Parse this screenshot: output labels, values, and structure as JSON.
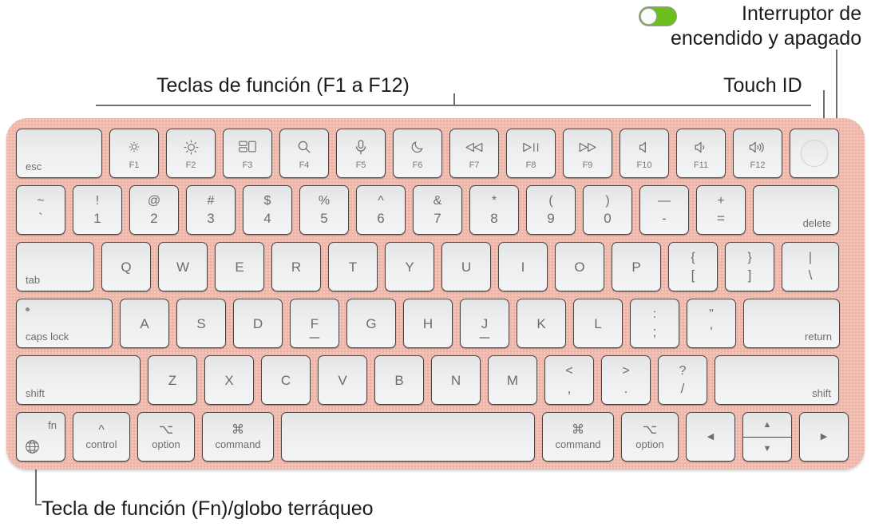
{
  "annotations": {
    "power_switch": {
      "line1": "Interruptor de",
      "line2": "encendido y apagado",
      "toggle_color": "#6dbe1e"
    },
    "touch_id": "Touch ID",
    "function_keys": "Teclas de función (F1 a F12)",
    "fn_globe": "Tecla de función (Fn)/globo terráqueo"
  },
  "keyboard": {
    "body_color": "#efb6aa",
    "rows": {
      "function_row": [
        {
          "name": "esc",
          "label": "esc",
          "type": "wide-bl"
        },
        {
          "name": "f1",
          "icon": "brightness-down-icon",
          "flabel": "F1"
        },
        {
          "name": "f2",
          "icon": "brightness-up-icon",
          "flabel": "F2"
        },
        {
          "name": "f3",
          "icon": "mission-control-icon",
          "flabel": "F3"
        },
        {
          "name": "f4",
          "icon": "spotlight-search-icon",
          "flabel": "F4"
        },
        {
          "name": "f5",
          "icon": "dictation-mic-icon",
          "flabel": "F5"
        },
        {
          "name": "f6",
          "icon": "do-not-disturb-moon-icon",
          "flabel": "F6"
        },
        {
          "name": "f7",
          "icon": "rewind-icon",
          "flabel": "F7"
        },
        {
          "name": "f8",
          "icon": "play-pause-icon",
          "flabel": "F8"
        },
        {
          "name": "f9",
          "icon": "fast-forward-icon",
          "flabel": "F9"
        },
        {
          "name": "f10",
          "icon": "mute-icon",
          "flabel": "F10"
        },
        {
          "name": "f11",
          "icon": "volume-down-icon",
          "flabel": "F11"
        },
        {
          "name": "f12",
          "icon": "volume-up-icon",
          "flabel": "F12"
        },
        {
          "name": "touch-id",
          "icon": "touch-id-icon"
        }
      ],
      "number_row": [
        {
          "name": "grave",
          "top": "~",
          "bottom": "`"
        },
        {
          "name": "key-1",
          "top": "!",
          "bottom": "1"
        },
        {
          "name": "key-2",
          "top": "@",
          "bottom": "2"
        },
        {
          "name": "key-3",
          "top": "#",
          "bottom": "3"
        },
        {
          "name": "key-4",
          "top": "$",
          "bottom": "4"
        },
        {
          "name": "key-5",
          "top": "%",
          "bottom": "5"
        },
        {
          "name": "key-6",
          "top": "^",
          "bottom": "6"
        },
        {
          "name": "key-7",
          "top": "&",
          "bottom": "7"
        },
        {
          "name": "key-8",
          "top": "*",
          "bottom": "8"
        },
        {
          "name": "key-9",
          "top": "(",
          "bottom": "9"
        },
        {
          "name": "key-0",
          "top": ")",
          "bottom": "0"
        },
        {
          "name": "minus",
          "top": "—",
          "bottom": "-"
        },
        {
          "name": "equal",
          "top": "+",
          "bottom": "="
        },
        {
          "name": "delete",
          "label": "delete"
        }
      ],
      "top_row": [
        {
          "name": "tab",
          "label": "tab"
        },
        {
          "name": "key-q",
          "label": "Q"
        },
        {
          "name": "key-w",
          "label": "W"
        },
        {
          "name": "key-e",
          "label": "E"
        },
        {
          "name": "key-r",
          "label": "R"
        },
        {
          "name": "key-t",
          "label": "T"
        },
        {
          "name": "key-y",
          "label": "Y"
        },
        {
          "name": "key-u",
          "label": "U"
        },
        {
          "name": "key-i",
          "label": "I"
        },
        {
          "name": "key-o",
          "label": "O"
        },
        {
          "name": "key-p",
          "label": "P"
        },
        {
          "name": "bracket-left",
          "top": "{",
          "bottom": "["
        },
        {
          "name": "bracket-right",
          "top": "}",
          "bottom": "]"
        },
        {
          "name": "backslash",
          "top": "|",
          "bottom": "\\"
        }
      ],
      "home_row": [
        {
          "name": "caps-lock",
          "label": "caps lock"
        },
        {
          "name": "key-a",
          "label": "A"
        },
        {
          "name": "key-s",
          "label": "S"
        },
        {
          "name": "key-d",
          "label": "D"
        },
        {
          "name": "key-f",
          "label": "F"
        },
        {
          "name": "key-g",
          "label": "G"
        },
        {
          "name": "key-h",
          "label": "H"
        },
        {
          "name": "key-j",
          "label": "J"
        },
        {
          "name": "key-k",
          "label": "K"
        },
        {
          "name": "key-l",
          "label": "L"
        },
        {
          "name": "semicolon",
          "top": ":",
          "bottom": ";"
        },
        {
          "name": "quote",
          "top": "\"",
          "bottom": "'"
        },
        {
          "name": "return",
          "label": "return"
        }
      ],
      "shift_row": [
        {
          "name": "shift-left",
          "label": "shift"
        },
        {
          "name": "key-z",
          "label": "Z"
        },
        {
          "name": "key-x",
          "label": "X"
        },
        {
          "name": "key-c",
          "label": "C"
        },
        {
          "name": "key-v",
          "label": "V"
        },
        {
          "name": "key-b",
          "label": "B"
        },
        {
          "name": "key-n",
          "label": "N"
        },
        {
          "name": "key-m",
          "label": "M"
        },
        {
          "name": "comma",
          "top": "<",
          "bottom": ","
        },
        {
          "name": "period",
          "top": ">",
          "bottom": "."
        },
        {
          "name": "slash",
          "top": "?",
          "bottom": "/"
        },
        {
          "name": "shift-right",
          "label": "shift"
        }
      ],
      "bottom_row": [
        {
          "name": "fn-globe",
          "label": "fn",
          "icon": "globe-icon"
        },
        {
          "name": "control-left",
          "sym": "^",
          "word": "control"
        },
        {
          "name": "option-left",
          "sym": "⌥",
          "word": "option"
        },
        {
          "name": "command-left",
          "sym": "⌘",
          "word": "command"
        },
        {
          "name": "space",
          "label": ""
        },
        {
          "name": "command-right",
          "sym": "⌘",
          "word": "command"
        },
        {
          "name": "option-right",
          "sym": "⌥",
          "word": "option"
        },
        {
          "name": "arrow-left",
          "icon": "arrow-left-icon"
        },
        {
          "name": "arrow-updown",
          "icon_up": "arrow-up-icon",
          "icon_down": "arrow-down-icon"
        },
        {
          "name": "arrow-right",
          "icon": "arrow-right-icon"
        }
      ]
    }
  }
}
